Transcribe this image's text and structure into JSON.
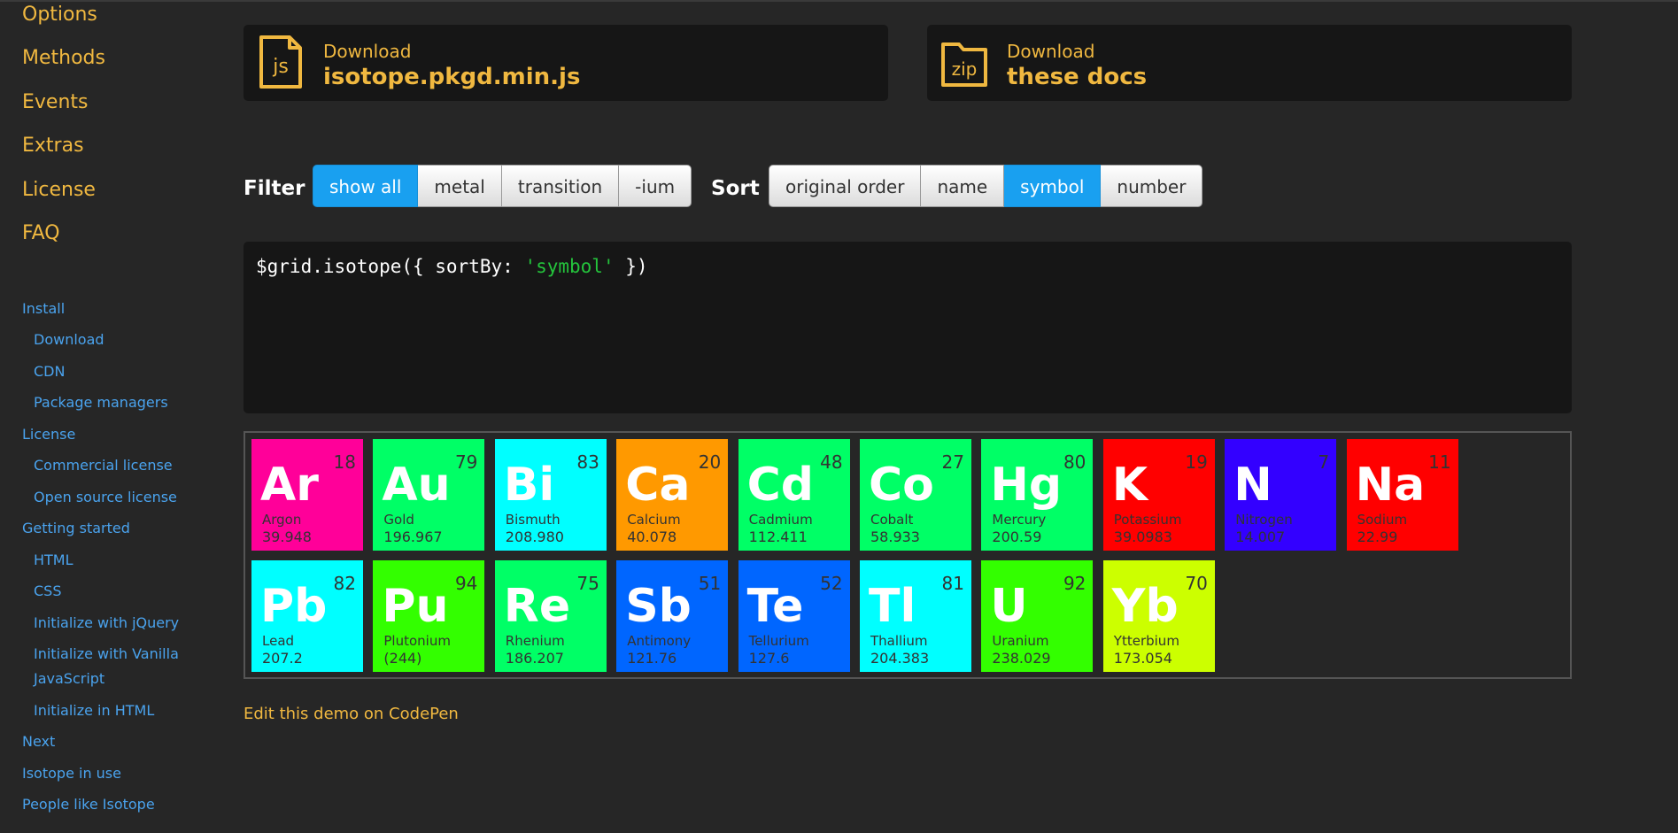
{
  "sidebar": {
    "main_links": [
      "Options",
      "Methods",
      "Events",
      "Extras",
      "License",
      "FAQ"
    ],
    "toc": [
      {
        "label": "Install",
        "level": 1
      },
      {
        "label": "Download",
        "level": 2
      },
      {
        "label": "CDN",
        "level": 2
      },
      {
        "label": "Package managers",
        "level": 2
      },
      {
        "label": "License",
        "level": 1
      },
      {
        "label": "Commercial license",
        "level": 2
      },
      {
        "label": "Open source license",
        "level": 2
      },
      {
        "label": "Getting started",
        "level": 1
      },
      {
        "label": "HTML",
        "level": 2
      },
      {
        "label": "CSS",
        "level": 2
      },
      {
        "label": "Initialize with jQuery",
        "level": 2
      },
      {
        "label": "Initialize with Vanilla",
        "level": 2
      },
      {
        "label": "JavaScript",
        "level": 2
      },
      {
        "label": "Initialize in HTML",
        "level": 2
      },
      {
        "label": "Next",
        "level": 1
      },
      {
        "label": "Isotope in use",
        "level": 1
      },
      {
        "label": "People like Isotope",
        "level": 1
      }
    ]
  },
  "downloads": [
    {
      "icon_text": "js",
      "icon": "js-file-icon",
      "line1": "Download",
      "line2": "isotope.pkgd.min.js"
    },
    {
      "icon_text": "zip",
      "icon": "zip-folder-icon",
      "line1": "Download",
      "line2": "these docs"
    }
  ],
  "filter": {
    "label": "Filter",
    "buttons": [
      "show all",
      "metal",
      "transition",
      "-ium"
    ],
    "active_index": 0
  },
  "sort": {
    "label": "Sort",
    "buttons": [
      "original order",
      "name",
      "symbol",
      "number"
    ],
    "active_index": 2
  },
  "code": {
    "prefix": "$grid.isotope({ sortBy: ",
    "string": "'symbol'",
    "suffix": " })"
  },
  "elements": [
    {
      "symbol": "Ar",
      "name": "Argon",
      "number": "18",
      "weight": "39.948",
      "color": "#ff0099"
    },
    {
      "symbol": "Au",
      "name": "Gold",
      "number": "79",
      "weight": "196.967",
      "color": "#00ff66"
    },
    {
      "symbol": "Bi",
      "name": "Bismuth",
      "number": "83",
      "weight": "208.980",
      "color": "#00ffff"
    },
    {
      "symbol": "Ca",
      "name": "Calcium",
      "number": "20",
      "weight": "40.078",
      "color": "#ff9900"
    },
    {
      "symbol": "Cd",
      "name": "Cadmium",
      "number": "48",
      "weight": "112.411",
      "color": "#00ff66"
    },
    {
      "symbol": "Co",
      "name": "Cobalt",
      "number": "27",
      "weight": "58.933",
      "color": "#00ff66"
    },
    {
      "symbol": "Hg",
      "name": "Mercury",
      "number": "80",
      "weight": "200.59",
      "color": "#00ff66"
    },
    {
      "symbol": "K",
      "name": "Potassium",
      "number": "19",
      "weight": "39.0983",
      "color": "#ff0000"
    },
    {
      "symbol": "N",
      "name": "Nitrogen",
      "number": "7",
      "weight": "14.007",
      "color": "#3300ff"
    },
    {
      "symbol": "Na",
      "name": "Sodium",
      "number": "11",
      "weight": "22.99",
      "color": "#ff0000"
    },
    {
      "symbol": "Pb",
      "name": "Lead",
      "number": "82",
      "weight": "207.2",
      "color": "#00ffff"
    },
    {
      "symbol": "Pu",
      "name": "Plutonium",
      "number": "94",
      "weight": "(244)",
      "color": "#33ff00"
    },
    {
      "symbol": "Re",
      "name": "Rhenium",
      "number": "75",
      "weight": "186.207",
      "color": "#00ff66"
    },
    {
      "symbol": "Sb",
      "name": "Antimony",
      "number": "51",
      "weight": "121.76",
      "color": "#0066ff"
    },
    {
      "symbol": "Te",
      "name": "Tellurium",
      "number": "52",
      "weight": "127.6",
      "color": "#0066ff"
    },
    {
      "symbol": "Tl",
      "name": "Thallium",
      "number": "81",
      "weight": "204.383",
      "color": "#00ffff"
    },
    {
      "symbol": "U",
      "name": "Uranium",
      "number": "92",
      "weight": "238.029",
      "color": "#33ff00"
    },
    {
      "symbol": "Yb",
      "name": "Ytterbium",
      "number": "70",
      "weight": "173.054",
      "color": "#ccff00"
    }
  ],
  "codepen_link": "Edit this demo on CodePen",
  "colors": {
    "accent": "#f0b840",
    "link": "#4aa3ee",
    "active_button": "#19a0f0"
  }
}
